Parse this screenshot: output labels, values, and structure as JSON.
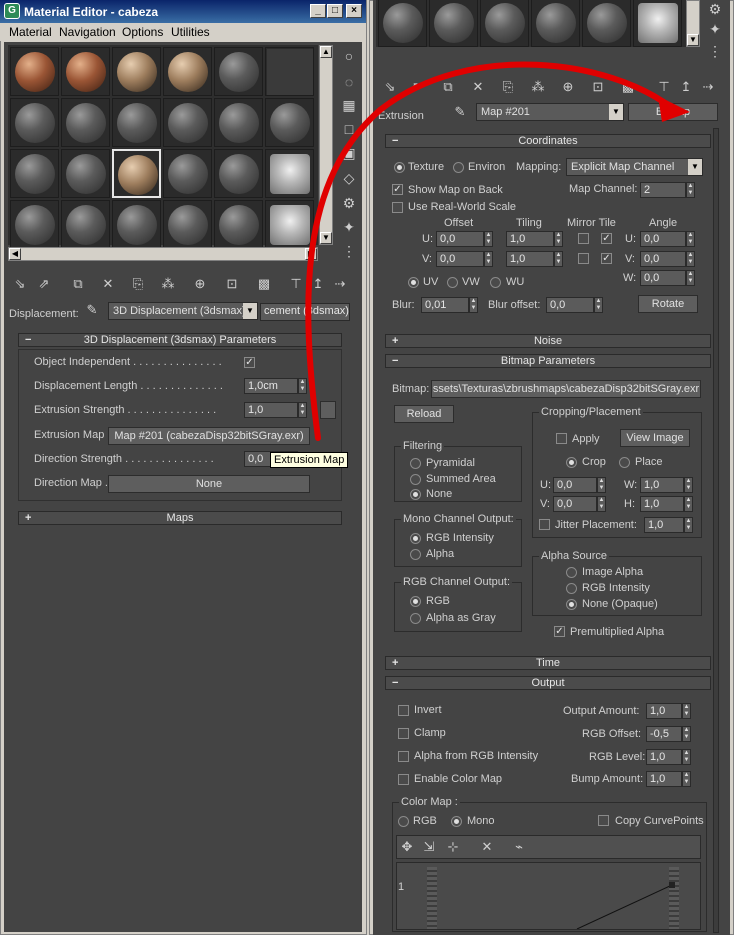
{
  "window": {
    "title": "Material Editor - cabeza"
  },
  "menu": [
    "Material",
    "Navigation",
    "Options",
    "Utilities"
  ],
  "left": {
    "displacement_label": "Displacement:",
    "type_dropdown": "3D Displacement (3dsmax)",
    "name_field": "cement (3dsmax)",
    "params_title": "3D Displacement (3dsmax) Parameters",
    "object_independent": "Object Independent . . . . . . . . . . . . . . .",
    "displacement_length": "Displacement Length . . . . . . . . . . . . . .",
    "displacement_length_value": "1,0cm",
    "extrusion_strength": "Extrusion Strength . . . . . . . . . . . . . . .",
    "extrusion_strength_value": "1,0",
    "extrusion_map": "Extrusion Map",
    "extrusion_map_button": "Map #201 (cabezaDisp32bitSGray.exr)",
    "direction_strength": "Direction Strength . . . . . . . . . . . . . . .",
    "direction_strength_value": "0,0",
    "tooltip": "Extrusion Map",
    "direction_map": "Direction Map .",
    "direction_map_button": "None",
    "maps_title": "Maps"
  },
  "right": {
    "extrusion_label": "Extrusion",
    "map_dropdown": "Map #201",
    "bitmap_button": "Bitmap",
    "coordinates": {
      "title": "Coordinates",
      "texture": "Texture",
      "environ": "Environ",
      "mapping_label": "Mapping:",
      "mapping_value": "Explicit Map Channel",
      "show_map_on_back": "Show Map on Back",
      "map_channel_label": "Map Channel:",
      "map_channel_value": "2",
      "real_world_scale": "Use Real-World Scale",
      "offset": "Offset",
      "tiling": "Tiling",
      "mirror_tile": "Mirror Tile",
      "angle": "Angle",
      "u": "U:",
      "v": "V:",
      "w": "W:",
      "offset_u": "0,0",
      "offset_v": "0,0",
      "tiling_u": "1,0",
      "tiling_v": "1,0",
      "angle_u": "0,0",
      "angle_v": "0,0",
      "angle_w": "0,0",
      "uv": "UV",
      "vw": "VW",
      "wu": "WU",
      "blur_label": "Blur:",
      "blur_value": "0,01",
      "blur_offset_label": "Blur offset:",
      "blur_offset_value": "0,0",
      "rotate": "Rotate"
    },
    "noise_title": "Noise",
    "bitmap_params": {
      "title": "Bitmap Parameters",
      "bitmap_label": "Bitmap:",
      "bitmap_path": "ssets\\Texturas\\zbrushmaps\\cabezaDisp32bitSGray.exr",
      "reload": "Reload",
      "cropping_title": "Cropping/Placement",
      "apply": "Apply",
      "view_image": "View Image",
      "crop": "Crop",
      "place": "Place",
      "u": "U:",
      "v": "V:",
      "w": "W:",
      "h": "H:",
      "crop_u": "0,0",
      "crop_v": "0,0",
      "crop_w": "1,0",
      "crop_h": "1,0",
      "jitter": "Jitter Placement:",
      "jitter_value": "1,0",
      "filtering_title": "Filtering",
      "pyramidal": "Pyramidal",
      "summed_area": "Summed Area",
      "none": "None",
      "mono_title": "Mono Channel Output:",
      "rgb_intensity": "RGB Intensity",
      "alpha": "Alpha",
      "rgb_channel_title": "RGB Channel Output:",
      "rgb": "RGB",
      "alpha_as_gray": "Alpha as Gray",
      "alpha_source_title": "Alpha Source",
      "image_alpha": "Image Alpha",
      "rgb_intensity2": "RGB Intensity",
      "none_opaque": "None (Opaque)",
      "premultiplied": "Premultiplied Alpha"
    },
    "time_title": "Time",
    "output": {
      "title": "Output",
      "invert": "Invert",
      "clamp": "Clamp",
      "alpha_from_rgb": "Alpha from RGB Intensity",
      "enable_color_map": "Enable Color Map",
      "output_amount_label": "Output Amount:",
      "output_amount": "1,0",
      "rgb_offset_label": "RGB Offset:",
      "rgb_offset": "-0,5",
      "rgb_level_label": "RGB Level:",
      "rgb_level": "1,0",
      "bump_amount_label": "Bump Amount:",
      "bump_amount": "1,0",
      "color_map_title": "Color Map :",
      "rgb": "RGB",
      "mono": "Mono",
      "copy_curve_points": "Copy CurvePoints",
      "curve_tick": "1"
    }
  },
  "colors": {
    "panel": "#444444",
    "arrow": "#e00000",
    "titlebar": "#0a246a"
  }
}
